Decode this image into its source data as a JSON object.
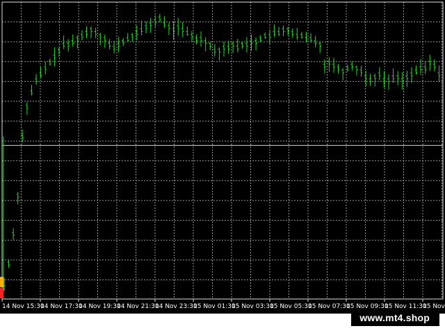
{
  "window": {
    "background": "#000000",
    "grid_color": "#9a9a9a",
    "axis_color": "#e0e0e0",
    "candle_color": "#22dd22",
    "marker_color_top": "#ffb000",
    "marker_color_bottom": "#ff2020"
  },
  "chart_data": {
    "type": "ohlc",
    "x_labels": [
      "14 Nov 15:30",
      "14 Nov 17:30",
      "14 Nov 19:30",
      "14 Nov 21:30",
      "14 Nov 23:30",
      "15 Nov 01:30",
      "15 Nov 03:30",
      "15 Nov 05:30",
      "15 Nov 07:30",
      "15 Nov 09:30",
      "15 Nov 11:30",
      "15 Nov"
    ],
    "bars_per_label": 8,
    "price_levels": [
      0.05,
      0.12,
      0.22,
      0.35,
      0.55,
      0.65,
      0.7,
      0.74,
      0.76,
      0.78,
      0.8,
      0.82,
      0.84,
      0.86,
      0.86,
      0.87,
      0.88,
      0.89,
      0.9,
      0.91,
      0.9,
      0.89,
      0.88,
      0.86,
      0.85,
      0.86,
      0.87,
      0.88,
      0.89,
      0.9,
      0.91,
      0.92,
      0.93,
      0.94,
      0.95,
      0.93,
      0.92,
      0.91,
      0.92,
      0.91,
      0.9,
      0.89,
      0.88,
      0.88,
      0.87,
      0.86,
      0.84,
      0.84,
      0.85,
      0.85,
      0.86,
      0.85,
      0.86,
      0.86,
      0.87,
      0.87,
      0.88,
      0.89,
      0.89,
      0.9,
      0.9,
      0.91,
      0.91,
      0.9,
      0.89,
      0.89,
      0.88,
      0.88,
      0.87,
      0.86,
      0.79,
      0.8,
      0.79,
      0.78,
      0.77,
      0.78,
      0.79,
      0.78,
      0.77,
      0.75,
      0.74,
      0.75,
      0.76,
      0.74,
      0.74,
      0.75,
      0.75,
      0.74,
      0.75,
      0.76,
      0.77,
      0.78,
      0.78,
      0.8,
      0.79,
      0.76
    ],
    "reference_level": 0.52,
    "grid": true
  },
  "watermark": {
    "text": "www.mt4.shop"
  }
}
